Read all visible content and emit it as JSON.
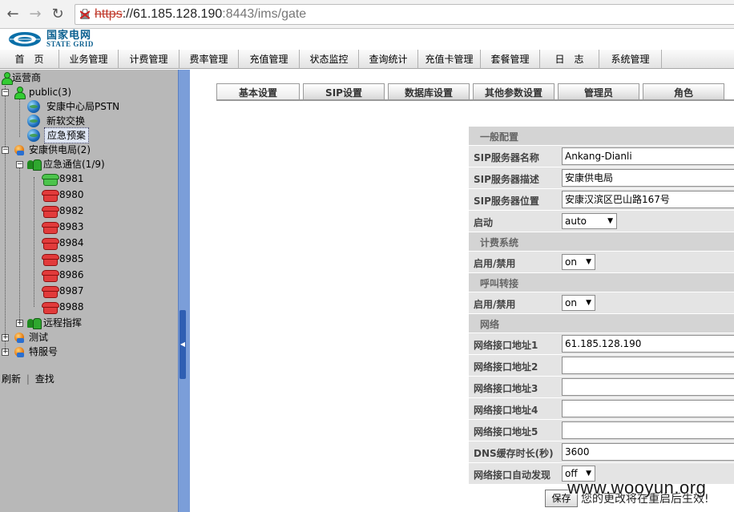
{
  "browser": {
    "url_scheme": "https",
    "url_host": "://61.185.128.190",
    "url_rest": ":8443/ims/gate"
  },
  "logo": {
    "cn": "国家电网",
    "en": "STATE GRID"
  },
  "menu": [
    "首　页",
    "业务管理",
    "计费管理",
    "费率管理",
    "充值管理",
    "状态监控",
    "查询统计",
    "充值卡管理",
    "套餐管理",
    "日　志",
    "系统管理"
  ],
  "tree": {
    "root": "运营商",
    "public": "public(3)",
    "public_children": [
      "安康中心局PSTN",
      "新软交换",
      "应急预案"
    ],
    "ankang": "安康供电局(2)",
    "emergency": "应急通信(1/9)",
    "extensions": [
      "8981",
      "8980",
      "8982",
      "8983",
      "8984",
      "8985",
      "8986",
      "8987",
      "8988"
    ],
    "remote": "远程指挥",
    "test": "测试",
    "special": "特服号",
    "action_refresh": "刷新",
    "separator": "|",
    "action_find": "查找"
  },
  "tabs": [
    "基本设置",
    "SIP设置",
    "数据库设置",
    "其他参数设置",
    "管理员",
    "角色"
  ],
  "form": {
    "sec_general": "一般配置",
    "sip_name_label": "SIP服务器名称",
    "sip_name_value": "Ankang-Dianli",
    "sip_desc_label": "SIP服务器描述",
    "sip_desc_value": "安康供电局",
    "sip_loc_label": "SIP服务器位置",
    "sip_loc_value": "安康汉滨区巴山路167号",
    "start_label": "启动",
    "start_value": "auto",
    "sec_billing": "计费系统",
    "billing_label": "启用/禁用",
    "billing_value": "on",
    "sec_forward": "呼叫转接",
    "forward_label": "启用/禁用",
    "forward_value": "on",
    "sec_network": "网络",
    "if1_label": "网络接口地址1",
    "if1_value": "61.185.128.190",
    "if2_label": "网络接口地址2",
    "if3_label": "网络接口地址3",
    "if4_label": "网络接口地址4",
    "if5_label": "网络接口地址5",
    "dns_label": "DNS缓存时长(秒)",
    "dns_value": "3600",
    "autodisc_label": "网络接口自动发现",
    "autodisc_value": "off"
  },
  "save_label": "保存",
  "save_note": "您的更改将在重启后生效!",
  "watermark": "www.wooyun.org"
}
